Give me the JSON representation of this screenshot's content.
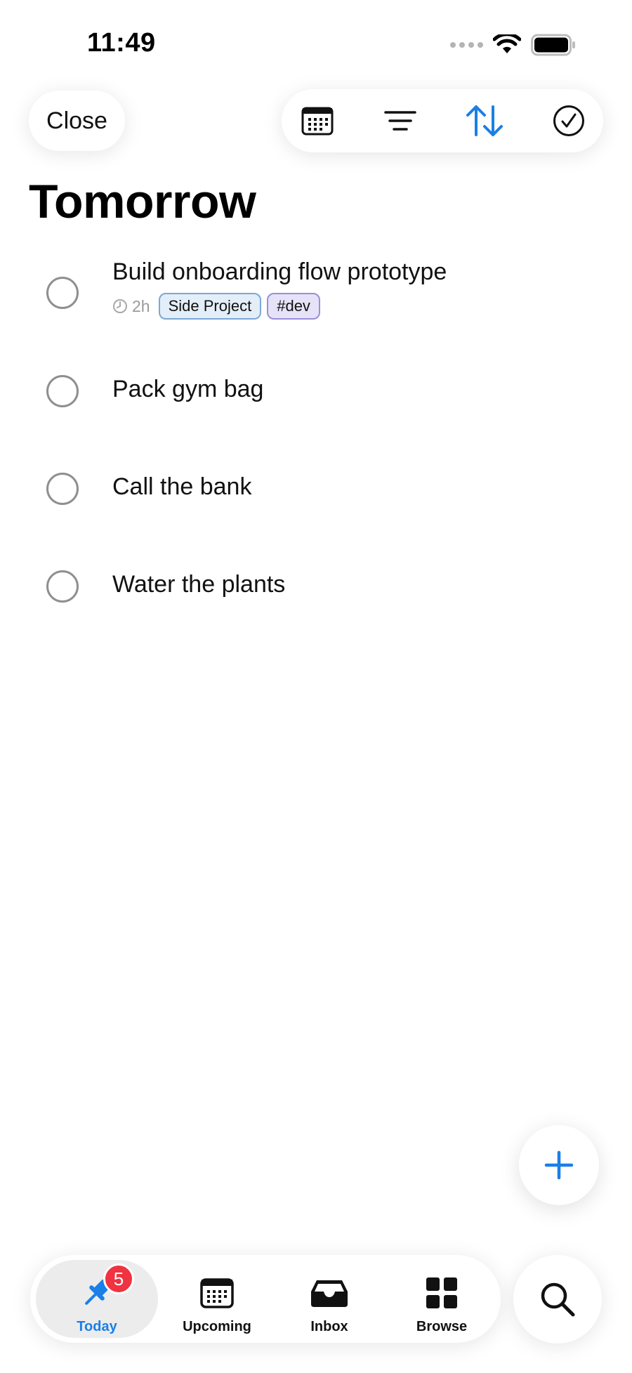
{
  "status_bar": {
    "time": "11:49"
  },
  "header": {
    "close_label": "Close",
    "toolbar_icons": [
      "calendar-icon",
      "filter-icon",
      "sort-icon",
      "checkmark-circle-icon"
    ],
    "title": "Tomorrow"
  },
  "tasks": [
    {
      "title": "Build onboarding flow prototype",
      "duration": "2h",
      "project": "Side Project",
      "tag": "#dev"
    },
    {
      "title": "Pack gym bag"
    },
    {
      "title": "Call the bank"
    },
    {
      "title": "Water the plants"
    }
  ],
  "tabbar": {
    "items": [
      {
        "label": "Today",
        "icon": "pin-icon",
        "badge": "5",
        "active": true
      },
      {
        "label": "Upcoming",
        "icon": "calendar-icon"
      },
      {
        "label": "Inbox",
        "icon": "inbox-icon"
      },
      {
        "label": "Browse",
        "icon": "grid-icon"
      }
    ],
    "search_icon": "search-icon"
  },
  "colors": {
    "accent": "#1a7fe6",
    "badge": "#ef3340",
    "project_chip": "#e3eef9",
    "tag_chip": "#e6e3f8"
  }
}
